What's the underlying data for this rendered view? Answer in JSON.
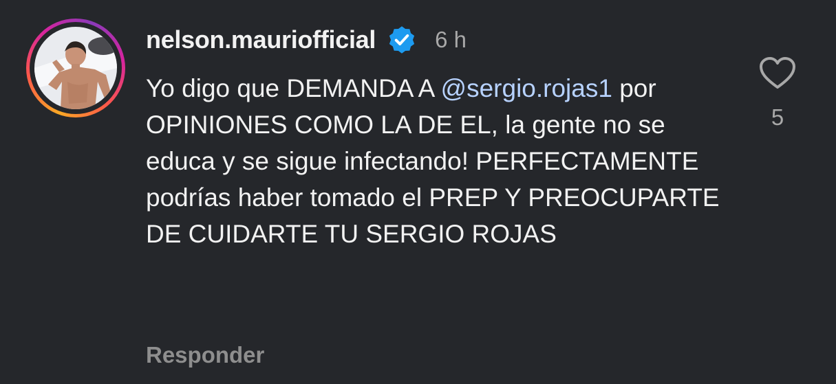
{
  "comment": {
    "username": "nelson.mauriofficial",
    "time": "6 h",
    "text_lead": "Yo digo que DEMANDA A ",
    "mention": "@sergio.rojas1",
    "text_rest": " por OPINIONES COMO LA DE EL, la gente no se educa y se sigue infectando! PERFECTAMENTE podrías haber tomado el PREP Y PREOCUPARTE DE CUIDARTE TU SERGIO ROJAS",
    "reply_label": "Responder",
    "like_count": "5"
  },
  "icons": {
    "verified": "verified-badge-icon",
    "like": "heart-outline-icon"
  },
  "colors": {
    "background": "#25272b",
    "mention": "#b7d2ff",
    "verified": "#1d9bf0",
    "secondary_text": "#a8a8a8"
  }
}
